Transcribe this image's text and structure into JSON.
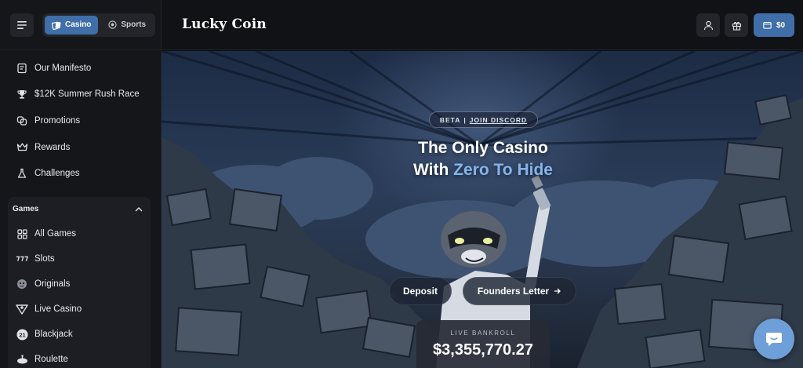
{
  "topbar": {
    "segments": [
      {
        "label": "Casino",
        "icon": "cards-icon",
        "active": true
      },
      {
        "label": "Sports",
        "icon": "ball-icon",
        "active": false
      }
    ]
  },
  "sidebar": {
    "items": [
      {
        "label": "Our Manifesto",
        "icon": "manifesto-icon"
      },
      {
        "label": "$12K Summer Rush Race",
        "icon": "trophy-icon"
      },
      {
        "label": "Promotions",
        "icon": "promotions-icon"
      },
      {
        "label": "Rewards",
        "icon": "crown-icon"
      },
      {
        "label": "Challenges",
        "icon": "flask-icon"
      }
    ],
    "games": {
      "title": "Games",
      "items": [
        {
          "label": "All Games",
          "icon": "grid-icon"
        },
        {
          "label": "Slots",
          "icon": "slots-777-icon"
        },
        {
          "label": "Originals",
          "icon": "originals-icon"
        },
        {
          "label": "Live Casino",
          "icon": "live-casino-icon"
        },
        {
          "label": "Blackjack",
          "icon": "blackjack-21-icon"
        },
        {
          "label": "Roulette",
          "icon": "roulette-icon"
        }
      ]
    }
  },
  "header": {
    "logo": "Lucky Coin",
    "wallet_balance": "$0"
  },
  "hero": {
    "beta": "BETA",
    "separator": "|",
    "join": "JOIN DISCORD",
    "headline_line1": "The Only Casino",
    "headline_with": "With",
    "headline_zero": "Zero To",
    "headline_hide": "Hide",
    "deposit_label": "Deposit",
    "founders_label": "Founders Letter",
    "bankroll_label": "LIVE BANKROLL",
    "bankroll_value": "$3,355,770.27"
  },
  "colors": {
    "accent": "#3f6ea8",
    "highlight": "#86b4ec",
    "chat_button": "#6f9fd8"
  }
}
